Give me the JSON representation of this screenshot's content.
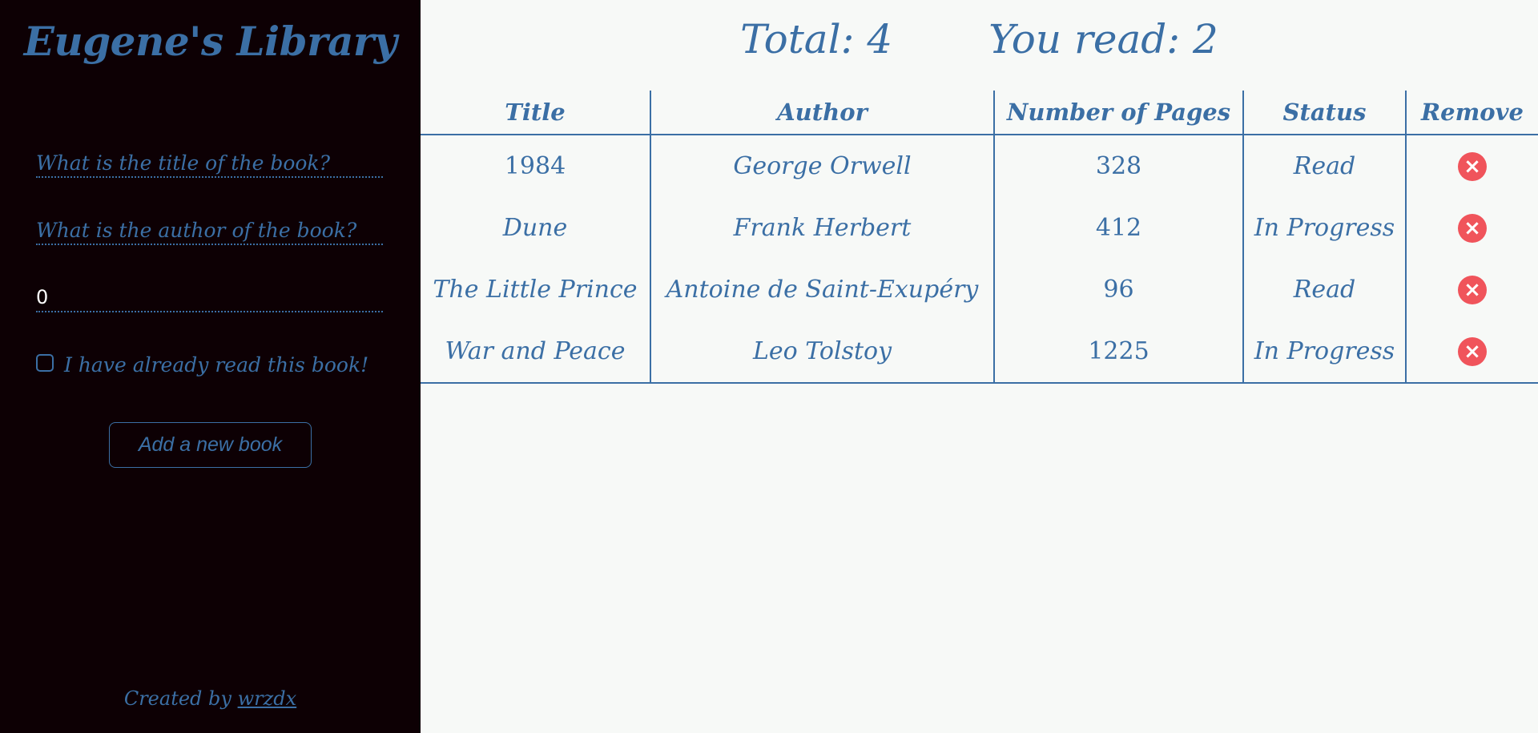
{
  "sidebar": {
    "brand": "Eugene's Library",
    "title_placeholder": "What is the title of the book?",
    "author_placeholder": "What is the author of the book?",
    "pages_value": "0",
    "read_label": "I have already read this book!",
    "add_button": "Add a new book",
    "credits_prefix": "Created by ",
    "credits_link": "wrzdx"
  },
  "summary": {
    "total": "Total: 4",
    "read": "You read: 2"
  },
  "table": {
    "headers": [
      "Title",
      "Author",
      "Number of Pages",
      "Status",
      "Remove"
    ],
    "rows": [
      {
        "title": "1984",
        "author": "George Orwell",
        "pages": "328",
        "status": "Read"
      },
      {
        "title": "Dune",
        "author": "Frank Herbert",
        "pages": "412",
        "status": "In Progress"
      },
      {
        "title": "The Little Prince",
        "author": "Antoine de Saint-Exupéry",
        "pages": "96",
        "status": "Read"
      },
      {
        "title": "War and Peace",
        "author": "Leo Tolstoy",
        "pages": "1225",
        "status": "In Progress"
      }
    ]
  },
  "icons": {
    "remove": "close-icon"
  },
  "colors": {
    "sidebar_bg": "#0d0004",
    "accent": "#3b6fa5",
    "main_bg": "#f7f9f7",
    "remove": "#f0545b"
  }
}
